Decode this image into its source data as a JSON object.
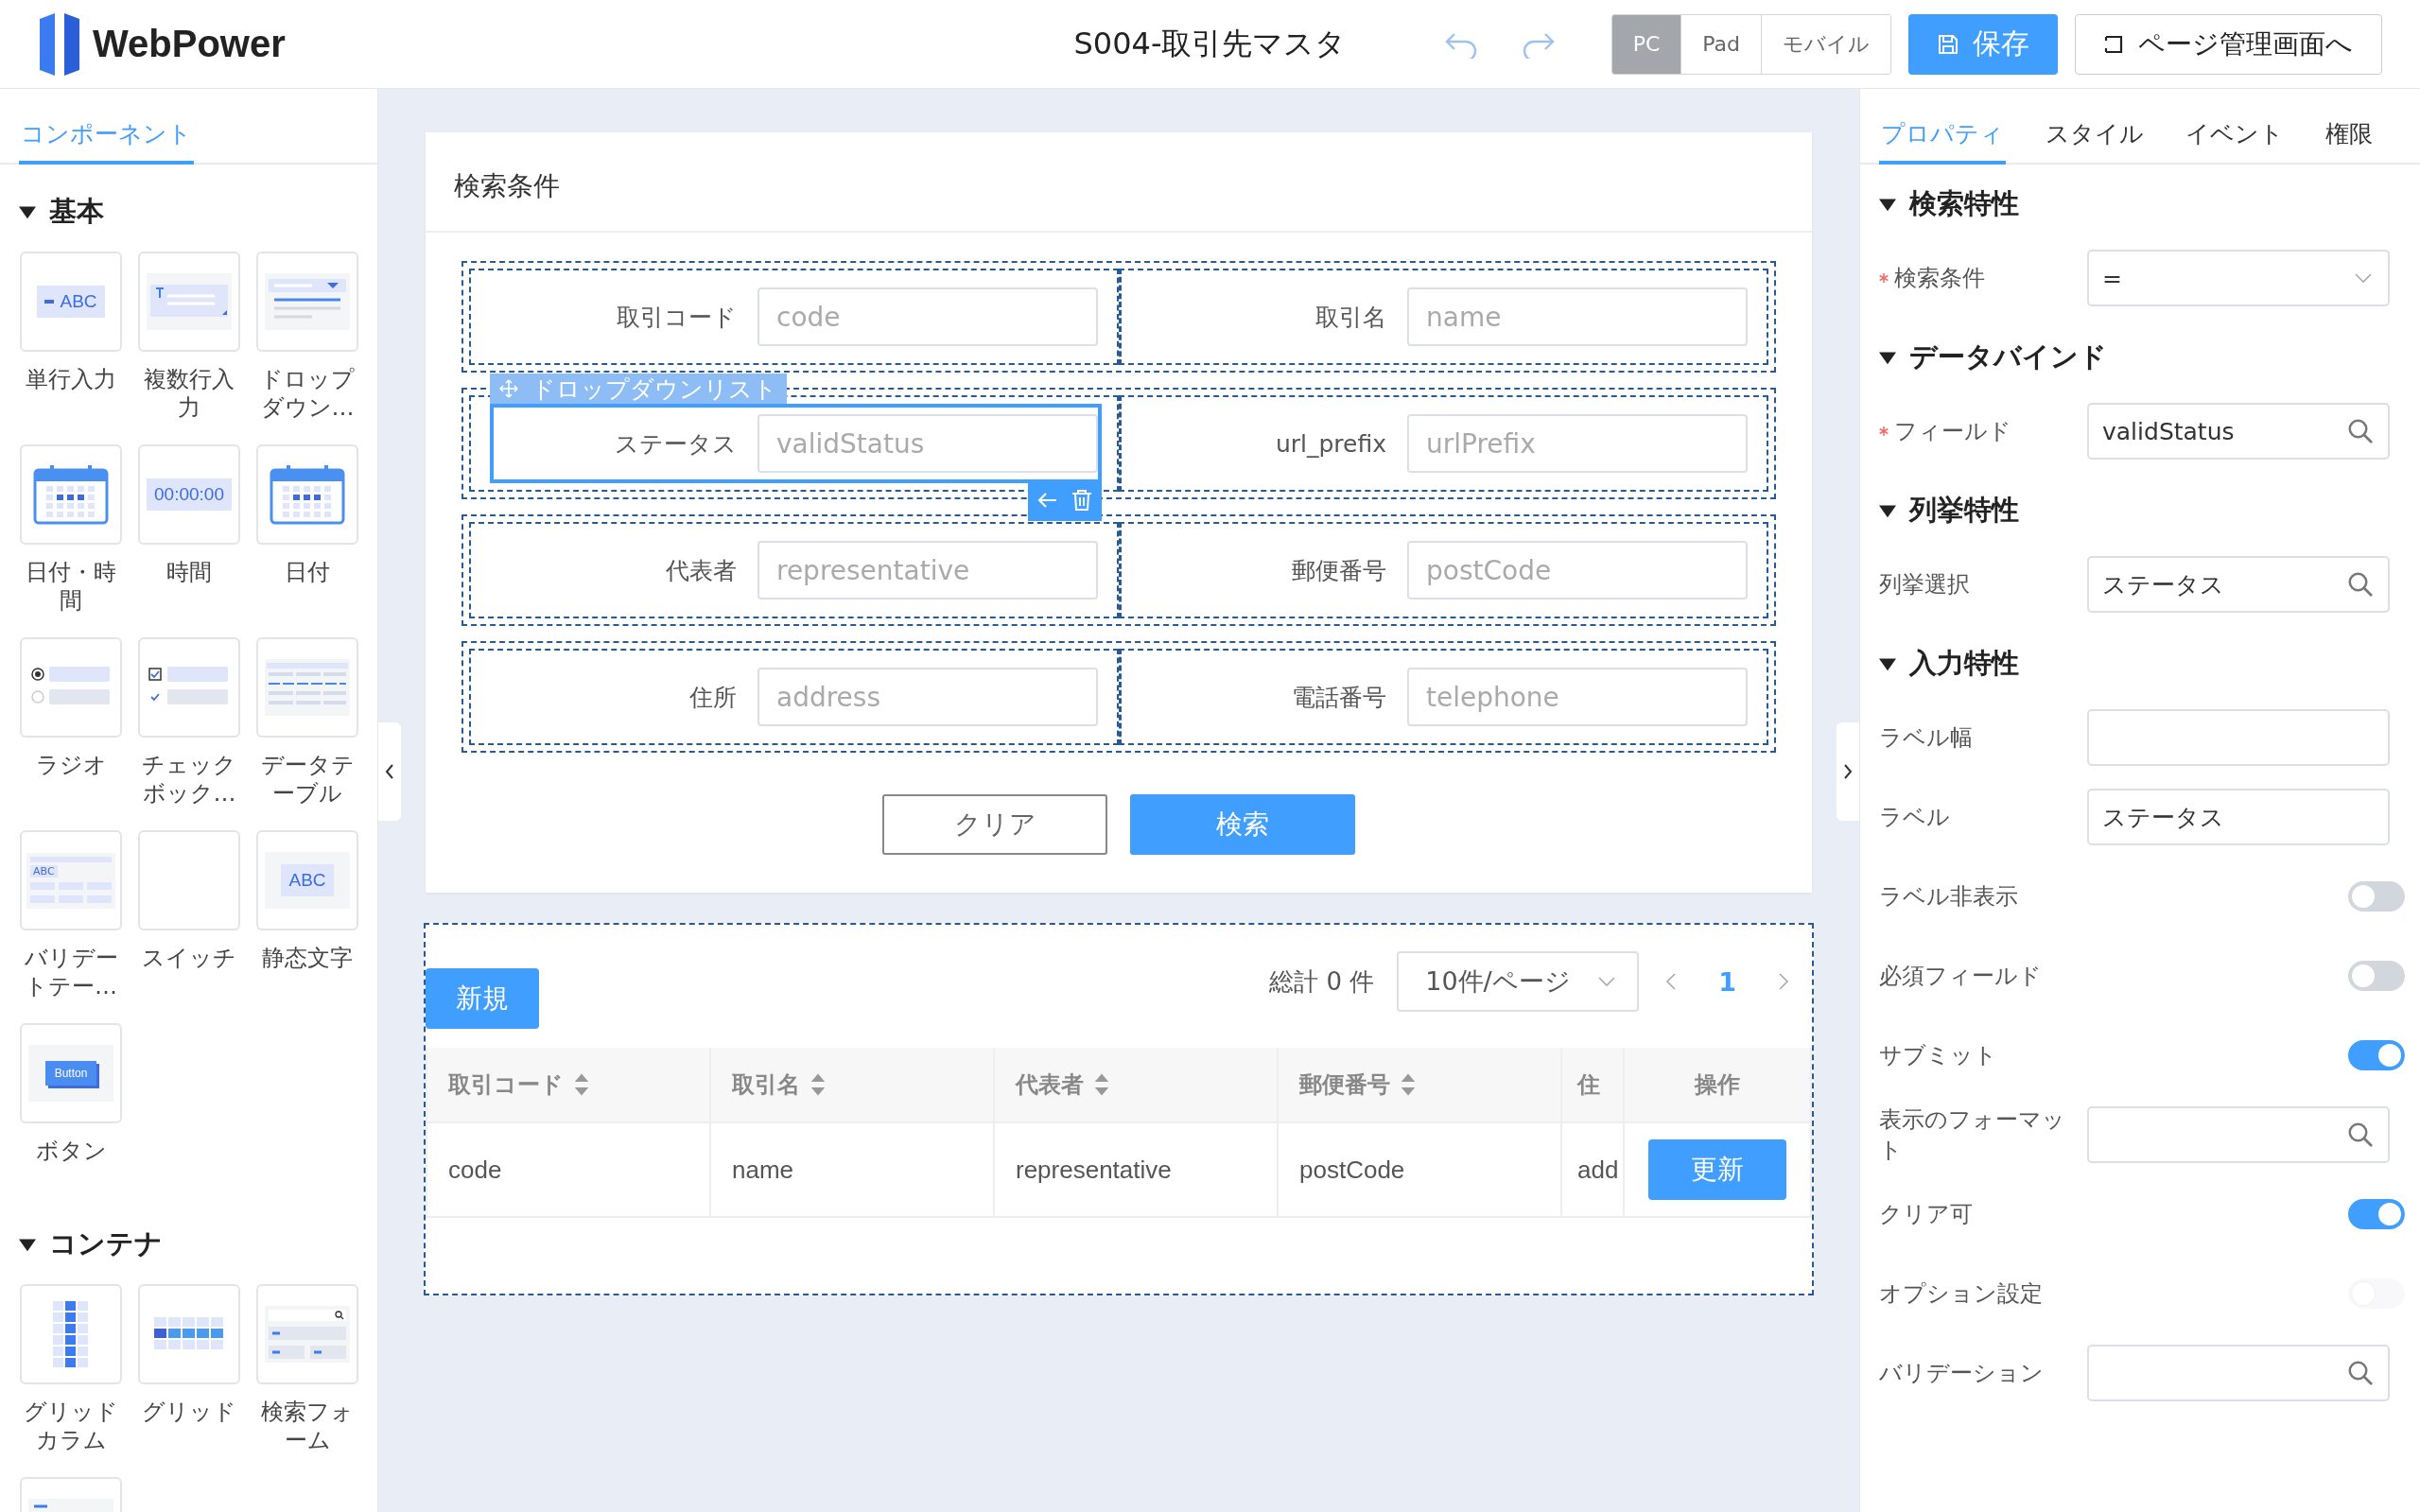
{
  "app": {
    "logo_text": "WebPower",
    "title": "S004-取引先マスタ",
    "devices": [
      {
        "label": "PC",
        "selected": true
      },
      {
        "label": "Pad",
        "selected": false
      },
      {
        "label": "モバイル",
        "selected": false
      }
    ],
    "save_button": "保存",
    "page_button": "ページ管理画面へ"
  },
  "components_panel": {
    "tabs": [
      {
        "label": "コンポーネント",
        "selected": true
      }
    ],
    "groups": [
      {
        "title": "基本",
        "expanded": true,
        "items": [
          {
            "label": "単行入力",
            "kind": "text-input",
            "preview_text": "ABC"
          },
          {
            "label": "複数行入力",
            "kind": "textarea"
          },
          {
            "label": "ドロップダウン…",
            "kind": "dropdown"
          },
          {
            "label": "日付・時間",
            "kind": "datetime"
          },
          {
            "label": "時間",
            "kind": "time",
            "preview_text": "00:00:00"
          },
          {
            "label": "日付",
            "kind": "date"
          },
          {
            "label": "ラジオ",
            "kind": "radio"
          },
          {
            "label": "チェックボック…",
            "kind": "checkbox"
          },
          {
            "label": "データテーブル",
            "kind": "datatable"
          },
          {
            "label": "バリデートテー…",
            "kind": "validation",
            "preview_text": "ABC"
          },
          {
            "label": "スイッチ",
            "kind": "switch"
          },
          {
            "label": "静态文字",
            "kind": "static-text",
            "preview_text": "ABC"
          },
          {
            "label": "ボタン",
            "kind": "button",
            "preview_text": "Button"
          }
        ]
      },
      {
        "title": "コンテナ",
        "expanded": true,
        "items": [
          {
            "label": "グリッドカラム",
            "kind": "grid-column"
          },
          {
            "label": "グリッド",
            "kind": "grid"
          },
          {
            "label": "検索フォーム",
            "kind": "search-form"
          },
          {
            "kind": "form"
          }
        ]
      }
    ]
  },
  "search_card": {
    "title": "検索条件",
    "rows": [
      {
        "fields": [
          {
            "label": "取引コード",
            "placeholder": "code",
            "selected": false
          },
          {
            "label": "取引名",
            "placeholder": "name",
            "selected": false
          }
        ]
      },
      {
        "fields": [
          {
            "label": "ステータス",
            "placeholder": "validStatus",
            "selected": true
          },
          {
            "label": "url_prefix",
            "placeholder": "urlPrefix",
            "selected": false
          }
        ]
      },
      {
        "fields": [
          {
            "label": "代表者",
            "placeholder": "representative",
            "selected": false
          },
          {
            "label": "郵便番号",
            "placeholder": "postCode",
            "selected": false
          }
        ]
      },
      {
        "fields": [
          {
            "label": "住所",
            "placeholder": "address",
            "selected": false
          },
          {
            "label": "電話番号",
            "placeholder": "telephone",
            "selected": false
          }
        ]
      }
    ],
    "selection_tag": "ドロップダウンリスト",
    "buttons": [
      {
        "label": "クリア",
        "kind": "secondary"
      },
      {
        "label": "検索",
        "kind": "primary"
      }
    ]
  },
  "table_card": {
    "new_button": "新規",
    "total": "総計 0 件",
    "page_size": "10件/ページ",
    "pages": [
      {
        "label": "1",
        "selected": true
      }
    ],
    "columns": [
      {
        "label": "取引コード",
        "sortable": true
      },
      {
        "label": "取引名",
        "sortable": true
      },
      {
        "label": "代表者",
        "sortable": true
      },
      {
        "label": "郵便番号",
        "sortable": true
      },
      {
        "label": "住",
        "sortable": false
      },
      {
        "label": "操作",
        "sortable": false
      }
    ],
    "rows": [
      {
        "cells": [
          "code",
          "name",
          "representative",
          "postCode",
          "add"
        ],
        "action": "更新"
      }
    ]
  },
  "properties_panel": {
    "tabs": [
      {
        "label": "プロパティ",
        "selected": true
      },
      {
        "label": "スタイル",
        "selected": false
      },
      {
        "label": "イベント",
        "selected": false
      },
      {
        "label": "権限",
        "selected": false
      }
    ],
    "sections": [
      {
        "title": "検索特性",
        "expanded": true,
        "rows": [
          {
            "kind": "select",
            "label": "検索条件",
            "required": true,
            "value": "="
          }
        ]
      },
      {
        "title": "データバインド",
        "expanded": true,
        "rows": [
          {
            "kind": "search",
            "label": "フィールド",
            "required": true,
            "value": "validStatus"
          }
        ]
      },
      {
        "title": "列挙特性",
        "expanded": true,
        "rows": [
          {
            "kind": "search",
            "label": "列挙選択",
            "required": false,
            "value": "ステータス"
          }
        ]
      },
      {
        "title": "入力特性",
        "expanded": true,
        "rows": [
          {
            "kind": "text",
            "label": "ラベル幅",
            "required": false
          },
          {
            "kind": "text",
            "label": "ラベル",
            "required": false,
            "value": "ステータス"
          },
          {
            "kind": "toggle",
            "label": "ラベル非表示",
            "required": false,
            "on": false,
            "disabled": false
          },
          {
            "kind": "toggle",
            "label": "必須フィールド",
            "required": false,
            "on": false,
            "disabled": false
          },
          {
            "kind": "toggle",
            "label": "サブミット",
            "required": false,
            "on": true,
            "disabled": false
          },
          {
            "kind": "search",
            "label": "表示のフォーマット",
            "required": false
          },
          {
            "kind": "toggle",
            "label": "クリア可",
            "required": false,
            "on": true,
            "disabled": false
          },
          {
            "kind": "toggle",
            "label": "オプション設定",
            "required": false,
            "on": false,
            "disabled": true
          },
          {
            "kind": "search",
            "label": "バリデーション",
            "required": false
          }
        ]
      }
    ]
  }
}
